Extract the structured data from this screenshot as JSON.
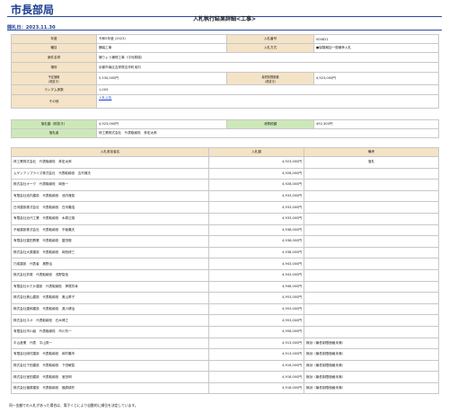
{
  "header": {
    "department": "市長部局",
    "page_title": "入札執行結果詳細<工事>",
    "open_date": "開札日：2023.11.30"
  },
  "info": {
    "fiscal_year_label": "年度",
    "fiscal_year": "令和5年度 (2023)",
    "bid_number_label": "入札番号",
    "bid_number": "000621",
    "category_label": "種目",
    "category": "舗装工事",
    "bid_method_label": "入札方式",
    "bid_method": "●保険競加一般競争入札",
    "project_name_label": "案件名称",
    "project_name": "擁りょう補修工事（中河原橋）",
    "location_label": "場所",
    "location": "京都市南区吉祥院吉作町池内",
    "planned_price_label": "予定価格",
    "planned_price_sub": "（税抜き）",
    "planned_price": "5,530,000円",
    "min_price_label": "最低制限価格",
    "min_price_sub": "（税抜き）",
    "min_price": "4,923,000円",
    "rank_label": "ランダム係数",
    "rank": "1.003",
    "other_label": "その他",
    "other_link": "入札公告"
  },
  "result": {
    "award_amount_label": "落札額（税抜き）",
    "award_amount": "4,923,000円",
    "tax_label": "消費税額",
    "tax": "492,300円",
    "winner_label": "落札者",
    "winner": "林工業株式会社　代表取締役　林宏太郎"
  },
  "bidders_table": {
    "headers": [
      "入札参加者名",
      "入札額",
      "備考"
    ],
    "rows": [
      {
        "name": "林工業株式会社　代表取締役　林宏太郎",
        "amount": "4,923,000円",
        "note": "落札"
      },
      {
        "name": "ムゲンアップライズ株式会社　代表取締役　吉村雅夫",
        "amount": "4,928,000円",
        "note": ""
      },
      {
        "name": "株式会社オーク　代表取締役　岡島一",
        "amount": "4,928,000円",
        "note": ""
      },
      {
        "name": "有限会社池内建設　代表取締役　池内雅俊",
        "amount": "4,933,000円",
        "note": ""
      },
      {
        "name": "白河建設株式会社　代表取締役　白河義浩",
        "amount": "4,933,000円",
        "note": ""
      },
      {
        "name": "有限会社近代工業　代表取締役　木原正雄",
        "amount": "4,933,000円",
        "note": ""
      },
      {
        "name": "不破建設株式会社　代表取締役　不破義夫",
        "amount": "4,938,000円",
        "note": ""
      },
      {
        "name": "有限会社冨田興業　代表取締役　冨田聡",
        "amount": "4,938,000円",
        "note": ""
      },
      {
        "name": "株式会社大原建設　代表取締役　岡西修三",
        "amount": "4,938,000円",
        "note": ""
      },
      {
        "name": "巧成建設　代表者　奥野治",
        "amount": "4,943,000円",
        "note": ""
      },
      {
        "name": "株式会社折原　代表取締役　浅野智信",
        "amount": "4,943,000円",
        "note": ""
      },
      {
        "name": "有限会社かたか建設　代表取締役　押尾芳幸",
        "amount": "4,948,000円",
        "note": ""
      },
      {
        "name": "株式会社奥山建設　代表取締役　奥山昇子",
        "amount": "4,953,000円",
        "note": ""
      },
      {
        "name": "株式会社建和建設　代表取締役　遠川健治",
        "amount": "4,953,000円",
        "note": ""
      },
      {
        "name": "株式会社ネオ　代表取締役　石木博之",
        "amount": "4,953,000円",
        "note": ""
      },
      {
        "name": "有限会社市川組　代表取締役　市川芳一",
        "amount": "4,958,000円",
        "note": ""
      },
      {
        "name": "平山産業　代表　平山秀一",
        "amount": "4,913,000円",
        "note": "無効（最低制限価格未満）"
      },
      {
        "name": "有限会社岡村建設　代表取締役　岡村義市",
        "amount": "4,913,000円",
        "note": "無効（最低制限価格未満）"
      },
      {
        "name": "株式会社下田建設　代表取締役　下田敏智",
        "amount": "4,918,000円",
        "note": "無効（最低制限価格未満）"
      },
      {
        "name": "株式会社宝田建設　代表取締役　宝田明",
        "amount": "4,918,000円",
        "note": "無効（最低制限価格未満）"
      },
      {
        "name": "株式会社福原建設　代表取締役　福原耕作",
        "amount": "4,918,000円",
        "note": "無効（最低制限価格未満）"
      }
    ]
  },
  "footer_note": "同一金額での入札があった場合は、電子くじにより自動的に順位を決定しています。"
}
